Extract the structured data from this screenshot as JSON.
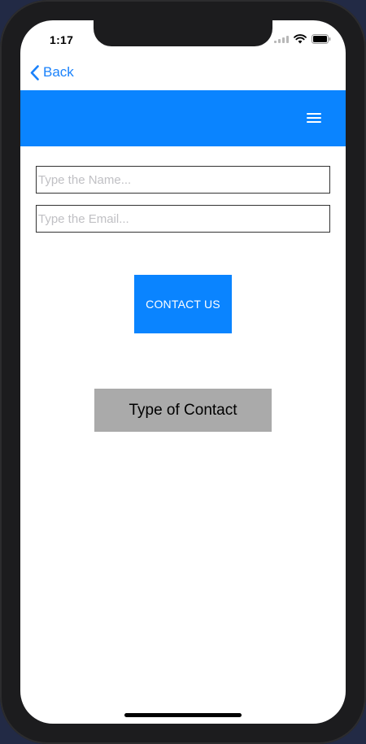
{
  "status_bar": {
    "time": "1:17"
  },
  "nav": {
    "back_label": "Back"
  },
  "form": {
    "name_placeholder": "Type the Name...",
    "name_value": "",
    "email_placeholder": "Type the Email...",
    "email_value": ""
  },
  "buttons": {
    "contact_us_label": "CONTACT US",
    "type_of_contact_label": "Type of Contact"
  },
  "colors": {
    "accent": "#0a84ff",
    "link": "#1a82fb",
    "type_button_bg": "#aaaaaa"
  },
  "icons": {
    "back": "chevron-left-icon",
    "menu": "hamburger-menu-icon",
    "signal": "cellular-signal-icon",
    "wifi": "wifi-icon",
    "battery": "battery-icon"
  }
}
